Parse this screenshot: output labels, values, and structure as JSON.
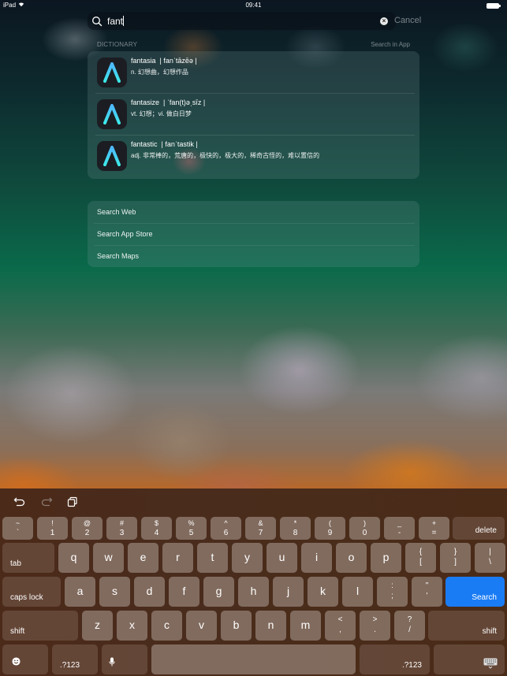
{
  "status_bar": {
    "device": "iPad",
    "wifi_icon": "wifi-icon",
    "time": "09:41",
    "battery_icon": "battery-icon"
  },
  "search": {
    "query": "fant",
    "clear_icon": "clear-icon",
    "cancel_label": "Cancel"
  },
  "dictionary": {
    "section_title": "DICTIONARY",
    "search_in_app_label": "Search in App",
    "entries": [
      {
        "word": "fantasia",
        "pronunciation": "| fanˈtāzēə |",
        "definition": "n. 幻想曲，幻想作品",
        "icon": "dictionary-app-icon"
      },
      {
        "word": "fantasize",
        "pronunciation": "| ˈfan(t)əˌsīz |",
        "definition": "vt. 幻想；vi. 做白日梦",
        "icon": "dictionary-app-icon"
      },
      {
        "word": "fantastic",
        "pronunciation": "| fanˈtastik |",
        "definition": "adj. 非常棒的，荒唐的，极快的，极大的，稀奇古怪的，难以置信的",
        "icon": "dictionary-app-icon"
      }
    ]
  },
  "suggestions": [
    {
      "label": "Search Web"
    },
    {
      "label": "Search App Store"
    },
    {
      "label": "Search Maps"
    }
  ],
  "keyboard": {
    "toolbar": [
      "undo-icon",
      "redo-icon",
      "paste-icon"
    ],
    "number_row": [
      {
        "top": "~",
        "bottom": "`"
      },
      {
        "top": "!",
        "bottom": "1"
      },
      {
        "top": "@",
        "bottom": "2"
      },
      {
        "top": "#",
        "bottom": "3"
      },
      {
        "top": "$",
        "bottom": "4"
      },
      {
        "top": "%",
        "bottom": "5"
      },
      {
        "top": "^",
        "bottom": "6"
      },
      {
        "top": "&",
        "bottom": "7"
      },
      {
        "top": "*",
        "bottom": "8"
      },
      {
        "top": "(",
        "bottom": "9"
      },
      {
        "top": ")",
        "bottom": "0"
      },
      {
        "top": "_",
        "bottom": "-"
      },
      {
        "top": "+",
        "bottom": "="
      }
    ],
    "delete_label": "delete",
    "tab_label": "tab",
    "row_q": [
      "q",
      "w",
      "e",
      "r",
      "t",
      "y",
      "u",
      "i",
      "o",
      "p"
    ],
    "row_q_symbols": [
      {
        "top": "{",
        "bottom": "["
      },
      {
        "top": "}",
        "bottom": "]"
      },
      {
        "top": "|",
        "bottom": "\\"
      }
    ],
    "caps_lock_label": "caps lock",
    "row_a": [
      "a",
      "s",
      "d",
      "f",
      "g",
      "h",
      "j",
      "k",
      "l"
    ],
    "row_a_symbols": [
      {
        "top": ":",
        "bottom": ";"
      },
      {
        "top": "\"",
        "bottom": "'"
      }
    ],
    "search_label": "Search",
    "search_color": "#1a7cf5",
    "shift_label": "shift",
    "row_z": [
      "z",
      "x",
      "c",
      "v",
      "b",
      "n",
      "m"
    ],
    "row_z_symbols": [
      {
        "top": "<",
        "bottom": ","
      },
      {
        "top": ">",
        "bottom": "."
      },
      {
        "top": "?",
        "bottom": "/"
      }
    ],
    "emoji_icon": "emoji-icon",
    "numbers_label": ".?123",
    "mic_icon": "microphone-icon",
    "dismiss_icon": "keyboard-dismiss-icon"
  }
}
